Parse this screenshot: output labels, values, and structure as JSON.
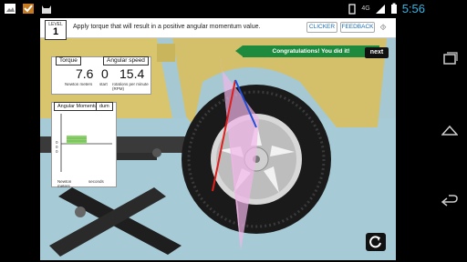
{
  "statusbar": {
    "network": "4G",
    "time": "5:56"
  },
  "app": {
    "level": {
      "word": "LEVEL",
      "number": "1"
    },
    "instruction": "Apply torque that will result in a positive angular momentum value.",
    "buttons": {
      "clicker": "CLICKER",
      "feedback": "FEEDBACK"
    },
    "banner": {
      "text": "Congratulations! You did it!",
      "next": "next"
    },
    "torque": {
      "tag": "Torque",
      "value": "7.6",
      "value2": "0",
      "unit": "Newton meters",
      "unit2": "start"
    },
    "speed": {
      "tag": "Angular speed",
      "value": "15.4",
      "unit": "rotations per minute (RPM)"
    },
    "graph": {
      "tag": "Angular Momentum",
      "tag2": "dum",
      "xlabel1": "Newton meters",
      "xlabel2": "seconds",
      "tick1": "0",
      "tick2": "0",
      "tick3": "0"
    }
  },
  "colors": {
    "topbar": "#ffffff",
    "banner": "#1e8a3e",
    "clock": "#33b5e5",
    "car": "#d8c56e",
    "sky": "#a5c8d3",
    "wedge": "#f1b5e8"
  }
}
